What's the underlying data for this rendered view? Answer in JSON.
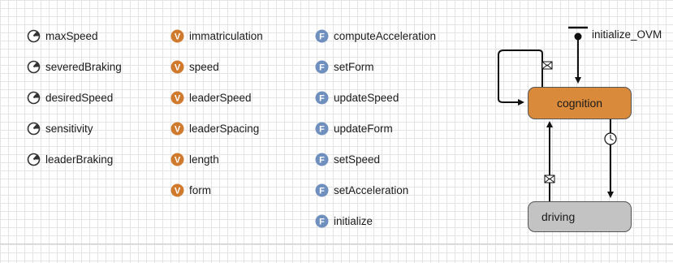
{
  "parameters": [
    {
      "label": "maxSpeed",
      "icon": "parameter-icon"
    },
    {
      "label": "severedBraking",
      "icon": "parameter-icon"
    },
    {
      "label": "desiredSpeed",
      "icon": "parameter-icon"
    },
    {
      "label": "sensitivity",
      "icon": "parameter-icon"
    },
    {
      "label": "leaderBraking",
      "icon": "parameter-icon"
    }
  ],
  "variables": [
    {
      "label": "immatriculation",
      "icon": "variable-icon",
      "badge": "V"
    },
    {
      "label": "speed",
      "icon": "variable-icon",
      "badge": "V"
    },
    {
      "label": "leaderSpeed",
      "icon": "variable-icon",
      "badge": "V"
    },
    {
      "label": "leaderSpacing",
      "icon": "variable-icon",
      "badge": "V"
    },
    {
      "label": "length",
      "icon": "variable-icon",
      "badge": "V"
    },
    {
      "label": "form",
      "icon": "variable-icon",
      "badge": "V"
    }
  ],
  "functions": [
    {
      "label": "computeAcceleration",
      "icon": "function-icon",
      "badge": "F"
    },
    {
      "label": "setForm",
      "icon": "function-icon",
      "badge": "F"
    },
    {
      "label": "updateSpeed",
      "icon": "function-icon",
      "badge": "F"
    },
    {
      "label": "updateForm",
      "icon": "function-icon",
      "badge": "F"
    },
    {
      "label": "setSpeed",
      "icon": "function-icon",
      "badge": "F"
    },
    {
      "label": "setAcceleration",
      "icon": "function-icon",
      "badge": "F"
    },
    {
      "label": "initialize",
      "icon": "function-icon",
      "badge": "F"
    }
  ],
  "statechart": {
    "entry_label": "initialize_OVM",
    "states": [
      {
        "label": "cognition",
        "color": "#d98a3a"
      },
      {
        "label": "driving",
        "color": "#c3c3c3"
      }
    ],
    "transition_icons": [
      "message-icon",
      "message-icon",
      "timeout-icon"
    ]
  },
  "colors": {
    "variable": "#d07a2e",
    "function": "#6f8fbf",
    "grid": "#e4e4e4"
  }
}
